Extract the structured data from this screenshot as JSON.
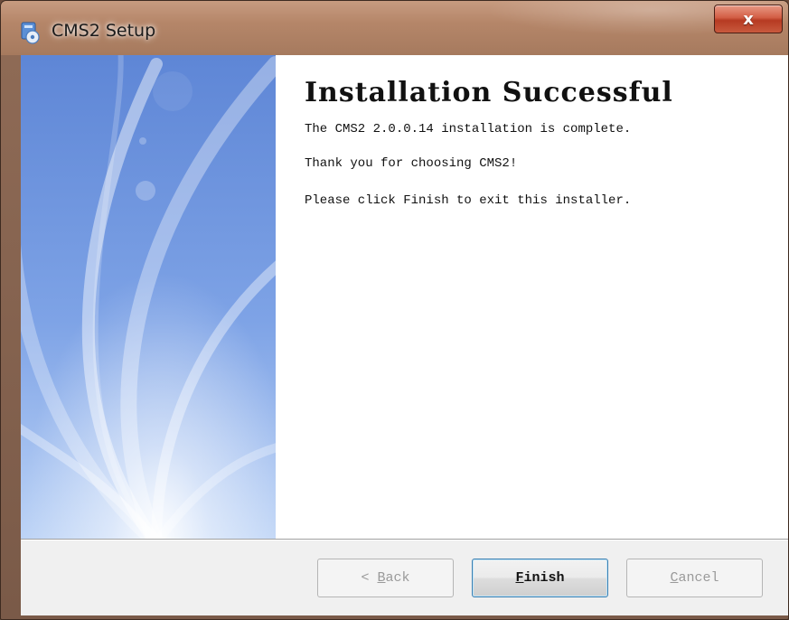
{
  "window": {
    "title": "CMS2 Setup",
    "close_glyph": "x",
    "app_icon": "installer-icon"
  },
  "content": {
    "heading": "Installation Successful",
    "lines": [
      "The CMS2 2.0.0.14 installation is complete.",
      "Thank you for choosing CMS2!",
      "Please click Finish to exit this installer."
    ]
  },
  "buttons": {
    "back": {
      "prefix": "< ",
      "mnemonic": "B",
      "rest": "ack",
      "enabled": false
    },
    "finish": {
      "mnemonic": "F",
      "rest": "inish",
      "enabled": true
    },
    "cancel": {
      "mnemonic": "C",
      "rest": "ancel",
      "enabled": false
    }
  },
  "colors": {
    "titlebar": "#b58669",
    "close_button": "#c84a30",
    "side_panel": "#6e97de",
    "default_button_border": "#3c7fb1"
  }
}
